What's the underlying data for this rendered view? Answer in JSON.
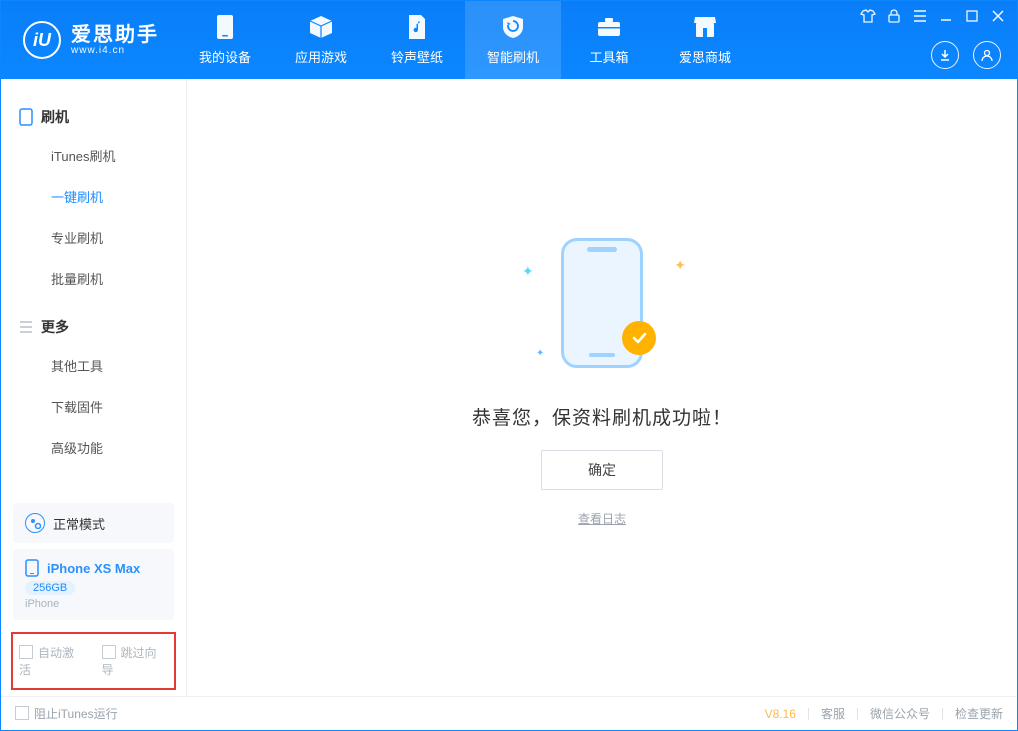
{
  "app": {
    "name": "爱思助手",
    "domain": "www.i4.cn",
    "logo_letter": "iU"
  },
  "nav": {
    "items": [
      {
        "label": "我的设备"
      },
      {
        "label": "应用游戏"
      },
      {
        "label": "铃声壁纸"
      },
      {
        "label": "智能刷机"
      },
      {
        "label": "工具箱"
      },
      {
        "label": "爱思商城"
      }
    ]
  },
  "sidebar": {
    "section1": {
      "title": "刷机",
      "items": [
        {
          "label": "iTunes刷机"
        },
        {
          "label": "一键刷机"
        },
        {
          "label": "专业刷机"
        },
        {
          "label": "批量刷机"
        }
      ]
    },
    "section2": {
      "title": "更多",
      "items": [
        {
          "label": "其他工具"
        },
        {
          "label": "下载固件"
        },
        {
          "label": "高级功能"
        }
      ]
    },
    "mode_card": {
      "label": "正常模式"
    },
    "device_card": {
      "name": "iPhone XS Max",
      "storage": "256GB",
      "type": "iPhone"
    },
    "options": {
      "auto_activate": "自动激活",
      "skip_guide": "跳过向导"
    }
  },
  "main": {
    "success_text": "恭喜您，保资料刷机成功啦！",
    "ok_button": "确定",
    "view_log": "查看日志"
  },
  "statusbar": {
    "block_itunes": "阻止iTunes运行",
    "version": "V8.16",
    "links": {
      "support": "客服",
      "wechat": "微信公众号",
      "check_update": "检查更新"
    }
  }
}
